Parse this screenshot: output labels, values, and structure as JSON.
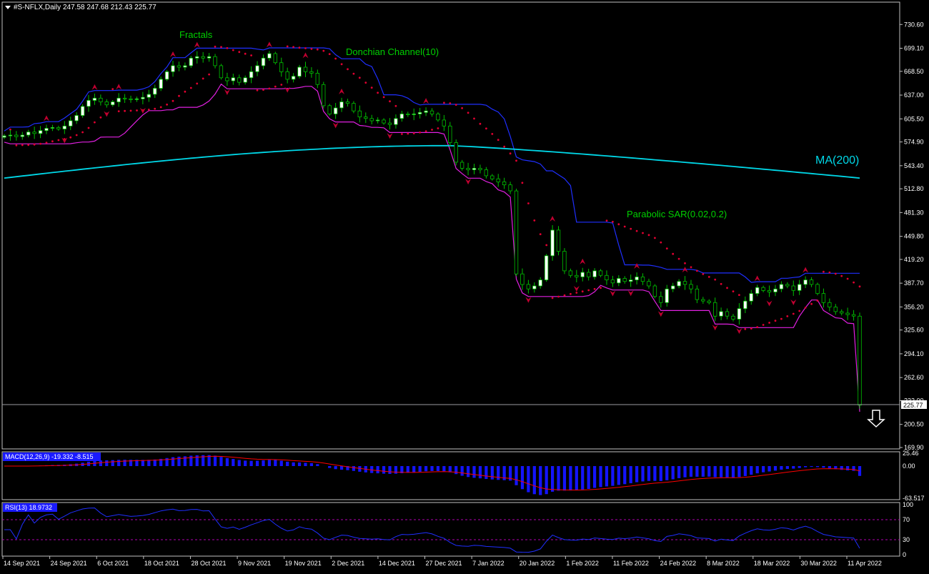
{
  "header": {
    "symbol": "#S-NFLX,Daily",
    "ohlc": "247.58 247.68 212.43 225.77",
    "menu_icon": "triangle-down-icon"
  },
  "colors": {
    "background": "#000000",
    "grid_border": "#c0c0c0",
    "candle_up": "#ffffff",
    "candle_down": "#ffffff",
    "candle_outline": "#00c000",
    "ma200": "#00d8e8",
    "donchian_upper": "#1f2fff",
    "donchian_lower": "#e020e0",
    "sar": "#e00030",
    "fractal": "#c00030",
    "annotation_text": "#00d000",
    "ma_label": "#00d8e8",
    "macd_hist": "#1414ff",
    "macd_signal": "#ff0000",
    "rsi_line": "#1f2fff",
    "rsi_level": "#b000b0",
    "arrow": "#ffffff"
  },
  "annotations": {
    "fractals": "Fractals",
    "donchian": "Donchian Channel(10)",
    "ma200": "MA(200)",
    "sar": "Parabolic SAR(0.02,0.2)"
  },
  "price_axis": {
    "ticks": [
      "730.60",
      "699.10",
      "668.50",
      "637.00",
      "605.50",
      "574.90",
      "543.40",
      "512.80",
      "481.30",
      "449.80",
      "419.20",
      "387.70",
      "356.20",
      "325.60",
      "294.10",
      "262.60",
      "232.00",
      "200.50",
      "169.90"
    ],
    "ylim": [
      169.9,
      746
    ],
    "last_price": "225.77"
  },
  "macd": {
    "label": "MACD(12,26,9) -19.332 -8.515",
    "ticks": [
      "25.46",
      "0.00",
      "-63.517"
    ]
  },
  "rsi": {
    "label": "RSI(13) 18.9732",
    "ticks": [
      "100",
      "70",
      "30",
      "0"
    ],
    "levels": [
      70,
      30
    ]
  },
  "date_axis": [
    "14 Sep 2021",
    "24 Sep 2021",
    "6 Oct 2021",
    "18 Oct 2021",
    "28 Oct 2021",
    "9 Nov 2021",
    "19 Nov 2021",
    "2 Dec 2021",
    "14 Dec 2021",
    "27 Dec 2021",
    "7 Jan 2022",
    "20 Jan 2022",
    "1 Feb 2022",
    "11 Feb 2022",
    "24 Feb 2022",
    "8 Mar 2022",
    "18 Mar 2022",
    "30 Mar 2022",
    "11 Apr 2022"
  ],
  "chart_data": {
    "type": "candlestick",
    "title": "#S-NFLX,Daily",
    "closes": [
      583,
      584,
      582,
      584,
      588,
      586,
      590,
      593,
      594,
      592,
      596,
      603,
      610,
      622,
      630,
      633,
      628,
      624,
      628,
      633,
      632,
      631,
      632,
      634,
      638,
      646,
      658,
      668,
      676,
      674,
      676,
      686,
      688,
      686,
      688,
      676,
      660,
      656,
      660,
      654,
      660,
      668,
      676,
      686,
      692,
      680,
      668,
      658,
      662,
      674,
      668,
      666,
      651,
      623,
      612,
      620,
      628,
      626,
      616,
      608,
      606,
      603,
      604,
      600,
      598,
      606,
      612,
      611,
      612,
      614,
      616,
      612,
      604,
      596,
      574,
      548,
      540,
      538,
      540,
      538,
      530,
      526,
      522,
      518,
      510,
      400,
      386,
      380,
      384,
      392,
      424,
      458,
      430,
      404,
      398,
      396,
      402,
      396,
      404,
      398,
      392,
      388,
      394,
      390,
      392,
      396,
      390,
      384,
      370,
      362,
      380,
      384,
      390,
      386,
      380,
      366,
      364,
      362,
      344,
      350,
      344,
      340,
      354,
      364,
      374,
      382,
      378,
      376,
      380,
      386,
      384,
      378,
      386,
      392,
      386,
      374,
      362,
      356,
      350,
      348,
      346,
      344,
      226
    ],
    "ma200": {
      "start": 527,
      "peak": 570,
      "end": 527
    },
    "ylim": [
      169.9,
      746
    ]
  }
}
